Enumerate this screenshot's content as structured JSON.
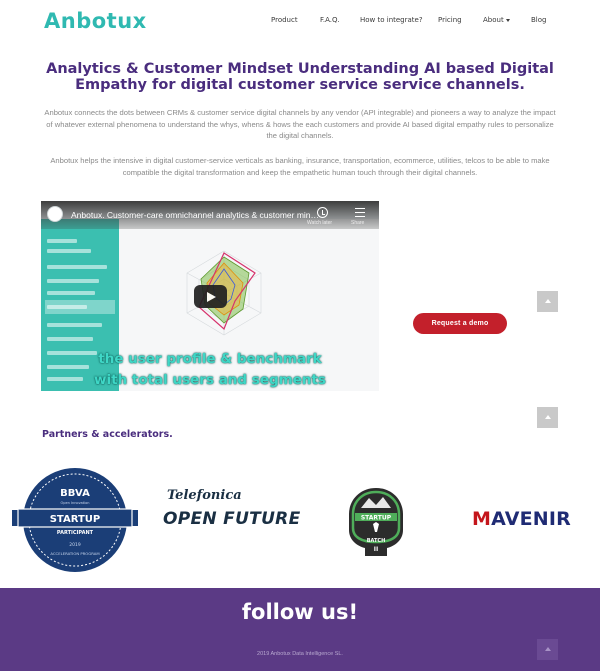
{
  "brand": {
    "logo_text": "Anbotux",
    "accent": "#2fb9b1",
    "title_color": "#4a2d7e",
    "footer_color": "#5b3a85"
  },
  "nav": {
    "items": [
      {
        "label": "Product"
      },
      {
        "label": "F.A.Q."
      },
      {
        "label": "How to integrate?"
      },
      {
        "label": "Pricing"
      },
      {
        "label": "About",
        "has_dropdown": true
      },
      {
        "label": "Blog"
      }
    ]
  },
  "hero": {
    "title": "Analytics & Customer Mindset Understanding AI based Digital Empathy for digital customer service service channels.",
    "paragraph_1": "Anbotux connects the dots between CRMs & customer service digital channels by any vendor (API integrable) and pioneers a way to analyze the impact of whatever external phenomena to understand the whys, whens & hows the each customers and provide AI based digital empathy rules to personalize the digital channels.",
    "paragraph_2": "Anbotux helps the intensive in digital customer-service verticals as banking, insurance, transportation, ecommerce, utilities, telcos to be able to make compatible the digital transformation and keep the empathetic human touch through their digital channels."
  },
  "video": {
    "title": "Anbotux. Customer-care omnichannel analytics & customer mindset understanding",
    "watch_later_label": "Watch later",
    "share_label": "Share",
    "caption_line_1": "the user profile & benchmark",
    "caption_line_2": "with total users and segments",
    "icons": [
      "play-icon",
      "clock-icon",
      "share-icon"
    ]
  },
  "cta": {
    "demo_label": "Request a demo",
    "color": "#c3202b"
  },
  "partners": {
    "heading": "Partners & accelerators.",
    "bbva": {
      "brand": "BBVA",
      "sub": "Open Innovation",
      "banner": "STARTUP",
      "banner_sub": "PARTICIPANT",
      "year": "2019",
      "program": "ACCELERATION PROGRAM"
    },
    "telefonica": {
      "top": "Telefonica",
      "bottom": "OPEN FUTURE"
    },
    "batch": {
      "top": "STARTUP",
      "bottom": "BATCH",
      "num": "II"
    },
    "mavenir": {
      "first": "M",
      "rest": "AVENIR"
    }
  },
  "footer": {
    "follow_label": "follow us!",
    "copyright": "2019 Anbotux Data Intelligence SL."
  }
}
